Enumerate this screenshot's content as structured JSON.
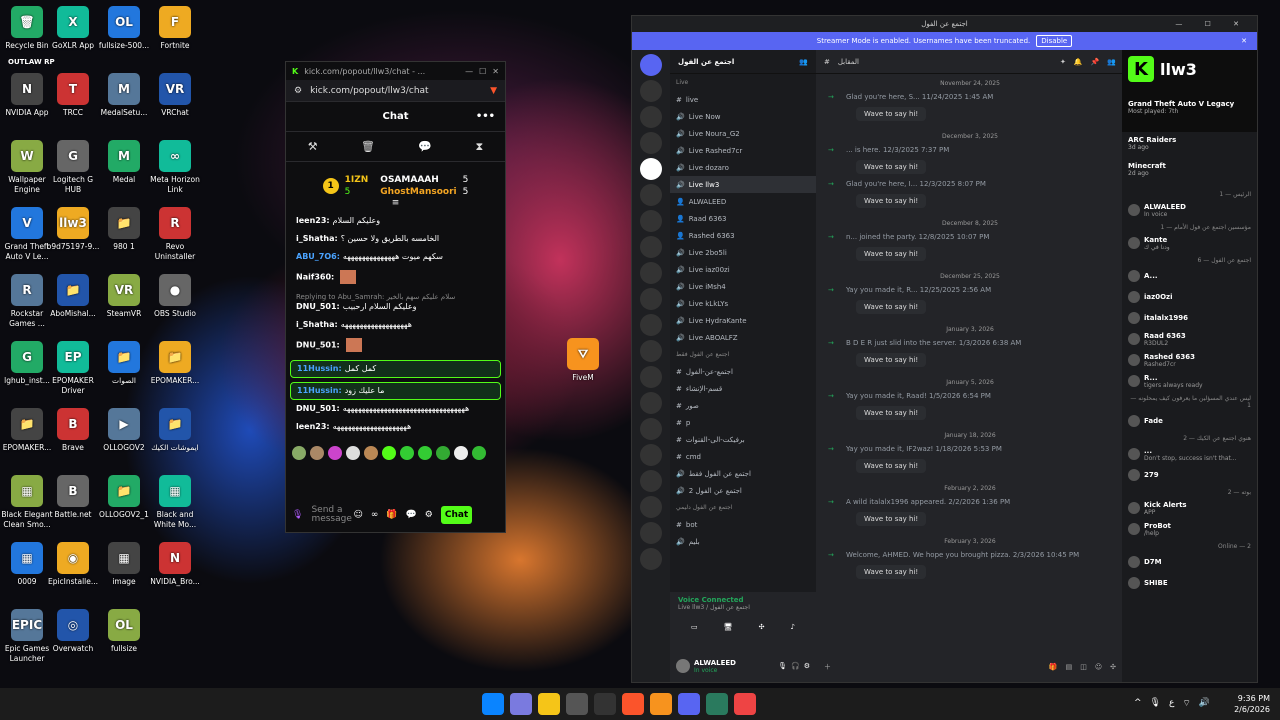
{
  "desktop": {
    "icons": [
      {
        "label": "Recycle Bin",
        "text": "🗑"
      },
      {
        "label": "GoXLR App",
        "text": "X"
      },
      {
        "label": "fullsize-500...",
        "text": "OL"
      },
      {
        "label": "Fortnite",
        "text": "F"
      },
      {
        "label": "NVIDIA App",
        "text": "N"
      },
      {
        "label": "TRCC",
        "text": "T"
      },
      {
        "label": "MedalSetu...",
        "text": "M"
      },
      {
        "label": "VRChat",
        "text": "VR"
      },
      {
        "label": "Wallpaper Engine",
        "text": "W"
      },
      {
        "label": "Logitech G HUB",
        "text": "G"
      },
      {
        "label": "Medal",
        "text": "M"
      },
      {
        "label": "Meta Horizon Link",
        "text": "∞"
      },
      {
        "label": "Grand Theft Auto V Le...",
        "text": "V"
      },
      {
        "label": "b9d75197-9...",
        "text": "llw3"
      },
      {
        "label": "980 1",
        "text": "📁"
      },
      {
        "label": "Revo Uninstaller",
        "text": "R"
      },
      {
        "label": "Rockstar Games ...",
        "text": "R"
      },
      {
        "label": "AboMishal...",
        "text": "📁"
      },
      {
        "label": "SteamVR",
        "text": "VR"
      },
      {
        "label": "OBS Studio",
        "text": "●"
      },
      {
        "label": "lghub_inst...",
        "text": "G"
      },
      {
        "label": "EPOMAKER Driver",
        "text": "EP"
      },
      {
        "label": "الصوات",
        "text": "📁"
      },
      {
        "label": "EPOMAKER...",
        "text": "📁"
      },
      {
        "label": "EPOMAKER...",
        "text": "📁"
      },
      {
        "label": "Brave",
        "text": "B"
      },
      {
        "label": "OLLOGOV2",
        "text": "▶"
      },
      {
        "label": "ايموشات الكيك",
        "text": "📁"
      },
      {
        "label": "Black Elegant Clean Smo...",
        "text": "▦"
      },
      {
        "label": "Battle.net",
        "text": "B"
      },
      {
        "label": "OLLOGOV2_1",
        "text": "📁"
      },
      {
        "label": "Black and White Mo...",
        "text": "▦"
      },
      {
        "label": "0009",
        "text": "▦"
      },
      {
        "label": "EpicInstalle...",
        "text": "◉"
      },
      {
        "label": "image",
        "text": "▦"
      },
      {
        "label": "NVIDIA_Bro...",
        "text": "N"
      },
      {
        "label": "Epic Games Launcher",
        "text": "EPIC"
      },
      {
        "label": "Overwatch",
        "text": "◎"
      },
      {
        "label": "fullsize",
        "text": "OL"
      },
      {
        "label": "FiveM",
        "text": "⛛"
      }
    ],
    "outlaw": "OUTLAW RP"
  },
  "kick": {
    "tab_title": "kick.com/popout/llw3/chat - ...",
    "url": "kick.com/popout/llw3/chat",
    "chat_title": "Chat",
    "lb": {
      "rank": "1",
      "streamer": "1IZN",
      "n1": "5",
      "gifter1": "OSAMAAAH",
      "g1": "5",
      "gifter2": "GhostMansoori",
      "g2": "5"
    },
    "messages": [
      {
        "user": "leen23:",
        "text": "وعليكم السلام",
        "color": "#fff"
      },
      {
        "user": "i_Shatha:",
        "text": "الخامسه بالطريق ولا حسين ؟",
        "color": "#fff"
      },
      {
        "user": "ABU_7O6:",
        "text": "سكهم ميوت ههههههههههههههه",
        "color": "#4aa3ff"
      },
      {
        "user": "Naif360:",
        "text": "",
        "color": "#fff"
      },
      {
        "user": "DNU_501:",
        "text": "وعليكم السلام ارحبيب",
        "color": "#fff",
        "reply": "Replying to Abu_Samrah: سلام عليكم سهم بالخير"
      },
      {
        "user": "i_Shatha:",
        "text": "ههههههههههههههههههه",
        "color": "#fff"
      },
      {
        "user": "DNU_501:",
        "text": "",
        "color": "#fff"
      },
      {
        "user": "11Hussin:",
        "text": "كمل كمل",
        "color": "#4aa3ff",
        "hl": true
      },
      {
        "user": "11Hussin:",
        "text": "ما عليك زود",
        "color": "#4aa3ff",
        "hl": true
      },
      {
        "user": "DNU_501:",
        "text": "هههههههههههههههههههههههههههههههههه",
        "color": "#fff"
      },
      {
        "user": "leen23:",
        "text": "ههههههههههههههههههههه",
        "color": "#fff"
      }
    ],
    "send_placeholder": "Send a message",
    "chat_button": "Chat"
  },
  "discord": {
    "title": "اجتمع عن الفول",
    "banner": "Streamer Mode is enabled. Usernames have been truncated.",
    "banner_btn": "Disable",
    "server": "اجتمع عن الفول",
    "channel_header": "المقابل",
    "channels": [
      {
        "name": "Live",
        "cat": true
      },
      {
        "name": "live",
        "type": "#"
      },
      {
        "name": "Live Now",
        "type": "🔊"
      },
      {
        "name": "Live Noura_G2",
        "type": "🔊"
      },
      {
        "name": "Live Rashed7cr",
        "type": "🔊"
      },
      {
        "name": "Live dozaro",
        "type": "🔊"
      },
      {
        "name": "Live llw3",
        "type": "🔊",
        "active": true
      },
      {
        "name": "ALWALEED",
        "type": "👤"
      },
      {
        "name": "Raad 6363",
        "type": "👤"
      },
      {
        "name": "Rashed 6363",
        "type": "👤"
      },
      {
        "name": "Live 2bo5li",
        "type": "🔊"
      },
      {
        "name": "Live iaz00zi",
        "type": "🔊"
      },
      {
        "name": "Live iMsh4",
        "type": "🔊"
      },
      {
        "name": "Live kLkLYs",
        "type": "🔊"
      },
      {
        "name": "Live HydraKante",
        "type": "🔊"
      },
      {
        "name": "Live ABOALFZ",
        "type": "🔊"
      },
      {
        "name": "اجتمع عن الفول فقط",
        "cat": true
      },
      {
        "name": "اجتمع-عن-الفول",
        "type": "#"
      },
      {
        "name": "قسم-الإنشاء",
        "type": "#"
      },
      {
        "name": "صور",
        "type": "#"
      },
      {
        "name": "p",
        "type": "#"
      },
      {
        "name": "برفيكت-الى-القنوات",
        "type": "#"
      },
      {
        "name": "cmd",
        "type": "#"
      },
      {
        "name": "اجتمع عن الفول فقط",
        "type": "🔊"
      },
      {
        "name": "اجتمع عن الفول 2",
        "type": "🔊"
      },
      {
        "name": "اجتمع عن الفول دليمي",
        "cat": true
      },
      {
        "name": "bot",
        "type": "#"
      },
      {
        "name": "بليم",
        "type": "🔊"
      }
    ],
    "voice": {
      "status": "Voice Connected",
      "sub": "Live llw3 / اجتمع عن الفول"
    },
    "user": {
      "name": "ALWALEED",
      "status": "In voice"
    },
    "feed": [
      {
        "day": "November 24, 2025",
        "text": "Glad you're here, S... 11/24/2025 1:45 AM"
      },
      {
        "day": "December 3, 2025",
        "text": "... is here. 12/3/2025 7:37 PM"
      },
      {
        "day": "",
        "text": "Glad you're here, I... 12/3/2025 8:07 PM"
      },
      {
        "day": "December 8, 2025",
        "text": "n... joined the party. 12/8/2025 10:07 PM"
      },
      {
        "day": "December 25, 2025",
        "text": "Yay you made it, R... 12/25/2025 2:56 AM"
      },
      {
        "day": "January 3, 2026",
        "text": "B D E R just slid into the server. 1/3/2026 6:38 AM"
      },
      {
        "day": "January 5, 2026",
        "text": "Yay you made it, Raad! 1/5/2026 6:54 PM"
      },
      {
        "day": "January 18, 2026",
        "text": "Yay you made it, IF2waz! 1/18/2026 5:53 PM"
      },
      {
        "day": "February 2, 2026",
        "text": "A wild italalx1996 appeared. 2/2/2026 1:36 PM"
      },
      {
        "day": "February 3, 2026",
        "text": "Welcome, AHMED. We hope you brought pizza. 2/3/2026 10:45 PM"
      }
    ],
    "wave": "Wave to say hi!",
    "members": [
      {
        "cat": "الرئيس — 1"
      },
      {
        "name": "ALWALEED",
        "sub": "In voice"
      },
      {
        "cat": "مؤسسين اجتمع عن فول الأمام — 1"
      },
      {
        "name": "Kante",
        "sub": "ودنا في ك"
      },
      {
        "cat": "اجتمع عن الفول — 6"
      },
      {
        "name": "A..."
      },
      {
        "name": "iaz0Ozi"
      },
      {
        "name": "italalx1996"
      },
      {
        "name": "Raad 6363",
        "sub": "R3DUL2"
      },
      {
        "name": "Rashed 6363",
        "sub": "Rashed7cr"
      },
      {
        "name": "R...",
        "sub": "tigers always ready"
      },
      {
        "cat": "ليس عندي المسؤلين ما يعرفون كيف يمحلونه — 1"
      },
      {
        "name": "Fade"
      },
      {
        "cat": "هنوي اجتمع عن الكيك — 2"
      },
      {
        "name": "...",
        "sub": "Don't stop, success isn't that..."
      },
      {
        "name": "279"
      },
      {
        "cat": "بوته — 2"
      },
      {
        "name": "Kick Alerts",
        "sub": "APP"
      },
      {
        "name": "ProBot",
        "sub": "/help"
      },
      {
        "cat": "Online — 2"
      },
      {
        "name": "D7M"
      },
      {
        "name": "SHIBE"
      }
    ],
    "stream_card": {
      "name": "llw3",
      "game": "Grand Theft Auto V Legacy",
      "played": "Most played: 7th",
      "g2": "ARC Raiders",
      "g2s": "3d ago",
      "g3": "Minecraft",
      "g3s": "2d ago"
    }
  },
  "taskbar": {
    "time": "9:36 PM",
    "date": "2/6/2026",
    "lang": "ع"
  }
}
